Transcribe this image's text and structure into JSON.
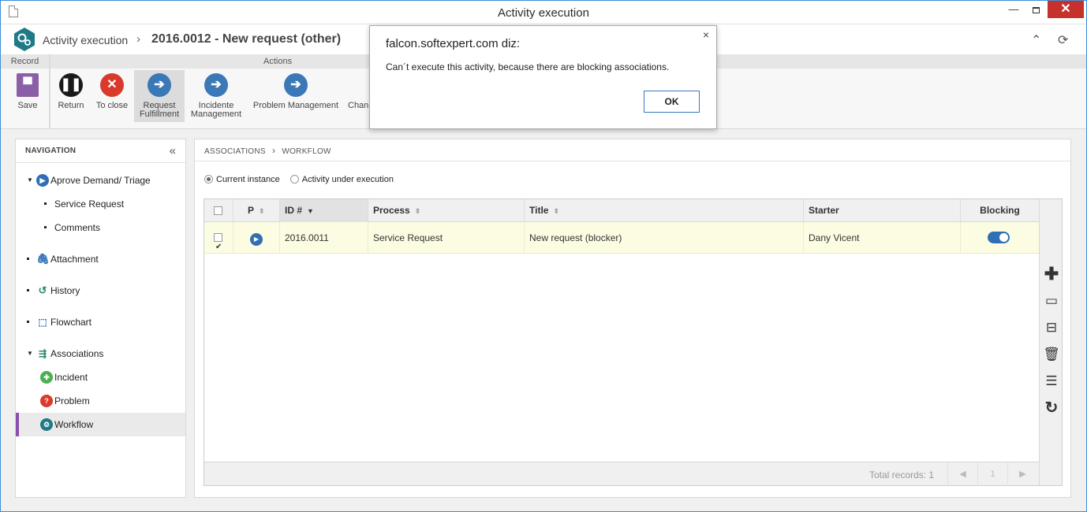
{
  "window": {
    "title": "Activity execution"
  },
  "header": {
    "crumb_root": "Activity execution",
    "crumb_sep": "›",
    "crumb_current": "2016.0012 - New request (other)"
  },
  "toolbar": {
    "record_group": "Record",
    "actions_group": "Actions",
    "save": "Save",
    "return": "Return",
    "to_close": "To close",
    "request_fulfillment_1": "Request",
    "request_fulfillment_2": "Fulfillment",
    "incidente_1": "Incidente",
    "incidente_2": "Management",
    "problem_management": "Problem Management",
    "change_truncated": "Chan"
  },
  "navigation": {
    "title": "NAVIGATION",
    "items": [
      {
        "label": "Aprove Demand/ Triage"
      },
      {
        "label": "Service Request"
      },
      {
        "label": "Comments"
      },
      {
        "label": "Attachment"
      },
      {
        "label": "History"
      },
      {
        "label": "Flowchart"
      },
      {
        "label": "Associations"
      },
      {
        "label": "Incident"
      },
      {
        "label": "Problem"
      },
      {
        "label": "Workflow"
      }
    ]
  },
  "content": {
    "breadcrumb_1": "ASSOCIATIONS",
    "breadcrumb_2": "WORKFLOW",
    "radio_current": "Current instance",
    "radio_activity": "Activity under execution"
  },
  "grid": {
    "columns": {
      "p": "P",
      "id": "ID #",
      "process": "Process",
      "title": "Title",
      "starter": "Starter",
      "blocking": "Blocking"
    },
    "rows": [
      {
        "id": "2016.0011",
        "process": "Service Request",
        "title": "New request (blocker)",
        "starter": "Dany Vicent",
        "blocking": true,
        "checked": true
      }
    ],
    "total_records": "Total records: 1",
    "pager_page": "1"
  },
  "dialog": {
    "title": "falcon.softexpert.com diz:",
    "message": "Can´t execute this activity, because there are blocking associations.",
    "ok": "OK",
    "close": "×"
  },
  "colors": {
    "accent_blue": "#2f6fb5",
    "close_red": "#c7312b",
    "active_purple": "#8a4fb0",
    "row_highlight": "#fcfce2"
  }
}
